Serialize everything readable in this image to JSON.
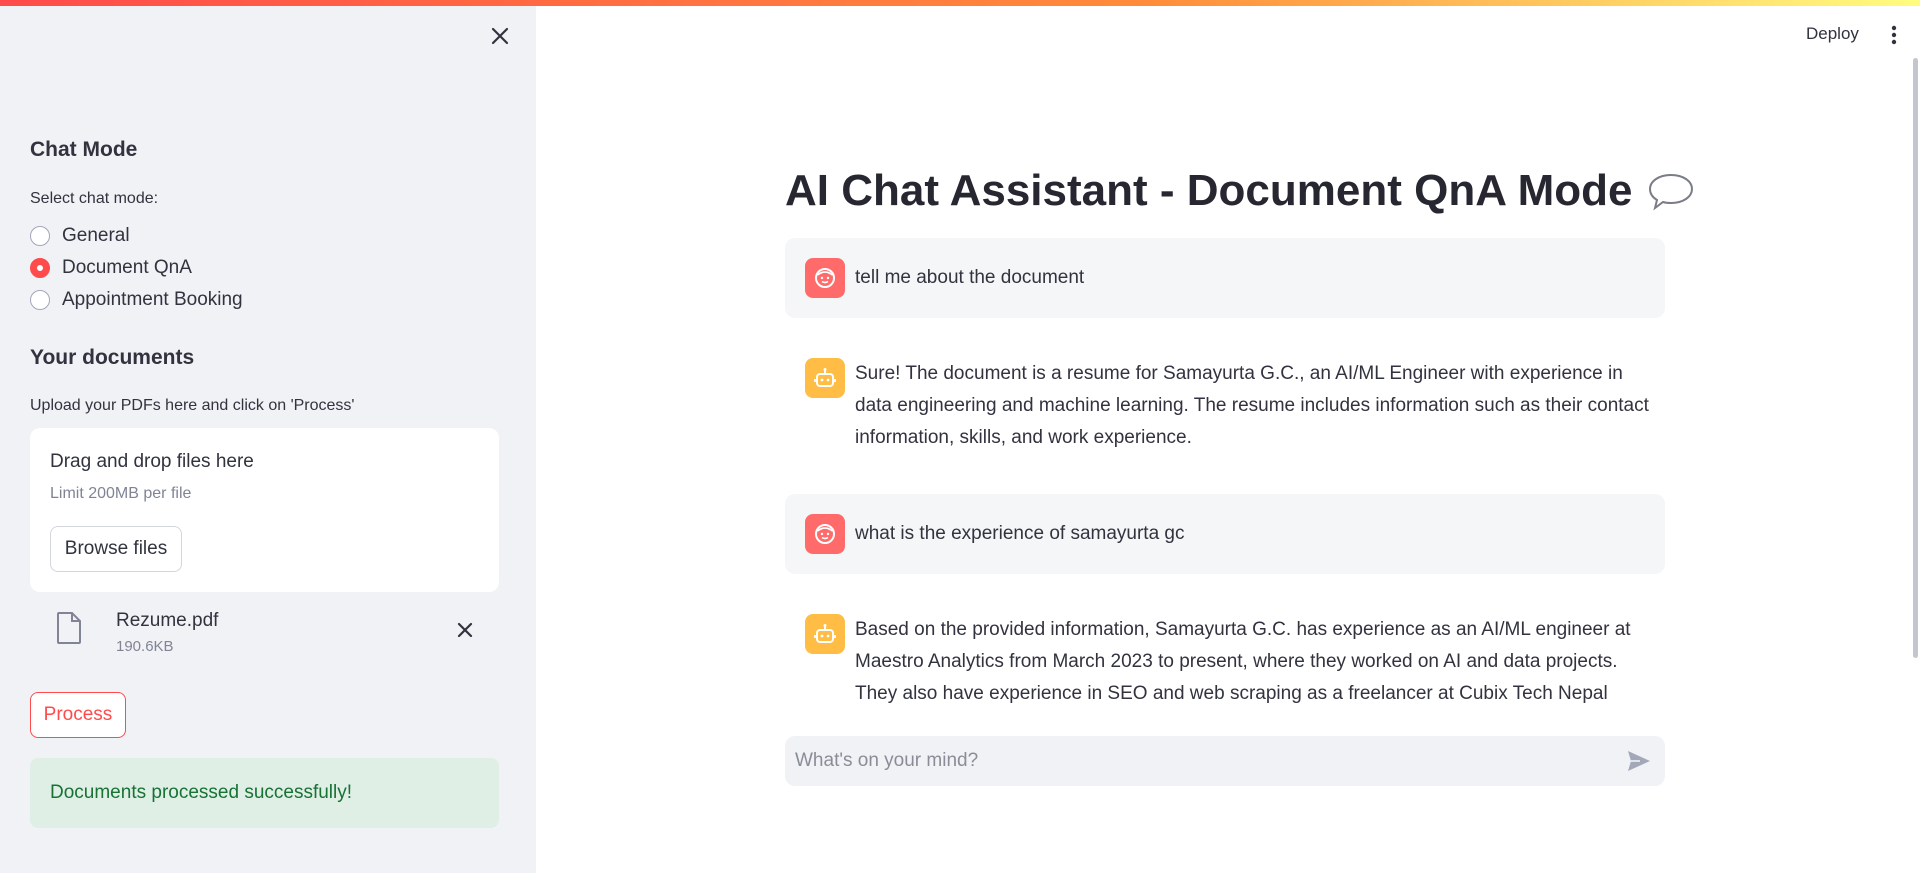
{
  "sidebar": {
    "chat_mode_heading": "Chat Mode",
    "select_label": "Select chat mode:",
    "modes": [
      {
        "label": "General",
        "selected": false
      },
      {
        "label": "Document QnA",
        "selected": true
      },
      {
        "label": "Appointment Booking",
        "selected": false
      }
    ],
    "documents_heading": "Your documents",
    "upload_hint": "Upload your PDFs here and click on 'Process'",
    "uploader": {
      "title": "Drag and drop files here",
      "limit": "Limit 200MB per file",
      "browse_label": "Browse files"
    },
    "file": {
      "name": "Rezume.pdf",
      "size": "190.6KB"
    },
    "process_label": "Process",
    "success_message": "Documents processed successfully!"
  },
  "header": {
    "deploy_label": "Deploy"
  },
  "main": {
    "title": "AI Chat Assistant - Document QnA Mode",
    "messages": [
      {
        "role": "user",
        "text": "tell me about the document"
      },
      {
        "role": "assistant",
        "text": "Sure! The document is a resume for Samayurta G.C., an AI/ML Engineer with experience in data engineering and machine learning. The resume includes information such as their contact information, skills, and work experience."
      },
      {
        "role": "user",
        "text": "what is the experience of samayurta gc"
      },
      {
        "role": "assistant",
        "text": "Based on the provided information, Samayurta G.C. has experience as an AI/ML engineer at Maestro Analytics from March 2023 to present, where they worked on AI and data projects. They also have experience in SEO and web scraping as a freelancer at Cubix Tech Nepal from October"
      }
    ],
    "input_placeholder": "What's on your mind?"
  },
  "colors": {
    "accent": "#ff4b4b",
    "sidebar_bg": "#f0f2f6",
    "success_bg": "#dfefe6",
    "success_text": "#177233",
    "user_avatar": "#ff6b6b",
    "bot_avatar": "#ffbd45"
  },
  "icons": [
    "close-icon",
    "radio-icon",
    "file-icon",
    "remove-file-icon",
    "speech-balloon-icon",
    "user-face-icon",
    "robot-icon",
    "send-icon",
    "more-vert-icon"
  ]
}
